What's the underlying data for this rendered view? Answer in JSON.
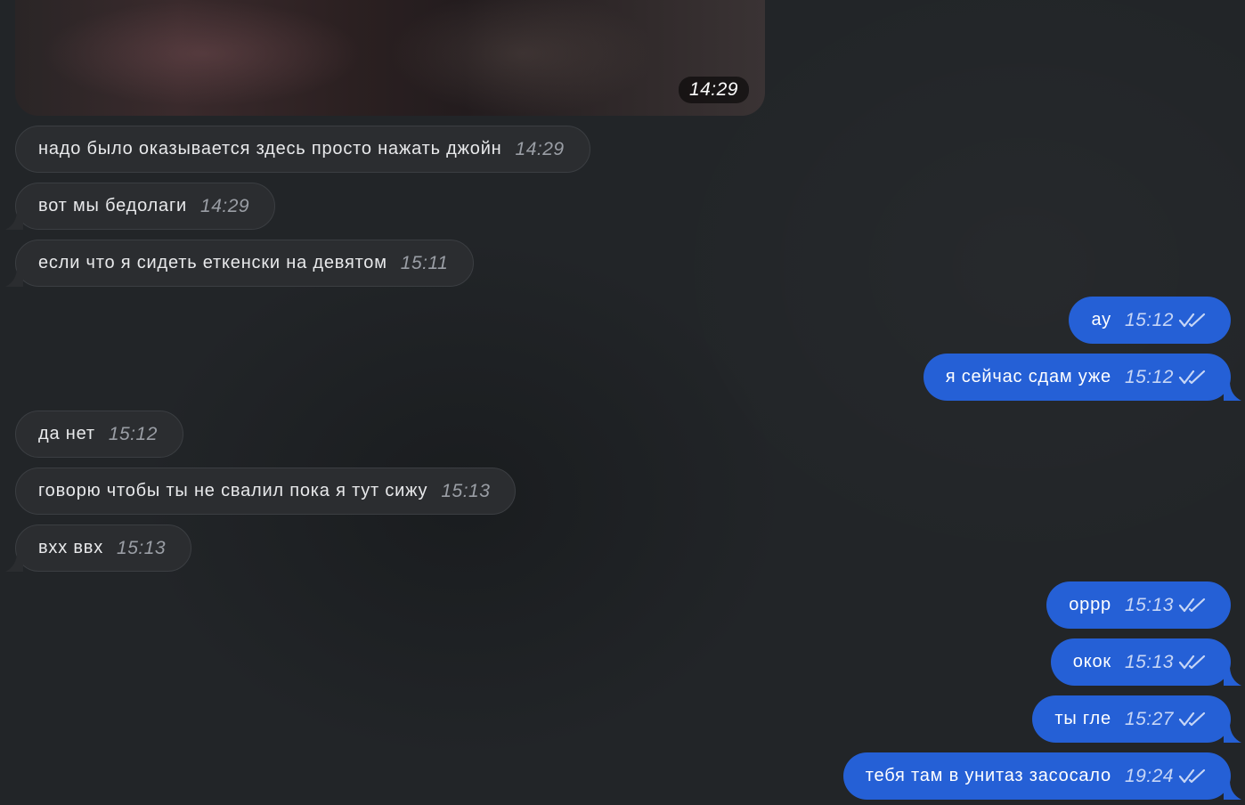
{
  "photo": {
    "time": "14:29"
  },
  "incoming": [
    {
      "text": "надо было оказывается здесь просто нажать джойн",
      "time": "14:29"
    },
    {
      "text": "вот мы бедолаги",
      "time": "14:29"
    },
    {
      "text": "если что я сидеть еткенски на девятом",
      "time": "15:11"
    },
    {
      "text": "да нет",
      "time": "15:12"
    },
    {
      "text": "говорю чтобы ты не свалил пока я тут сижу",
      "time": "15:13"
    },
    {
      "text": "вхх ввх",
      "time": "15:13"
    }
  ],
  "outgoing": [
    {
      "text": "ау",
      "time": "15:12"
    },
    {
      "text": "я сейчас сдам уже",
      "time": "15:12"
    },
    {
      "text": "оррр",
      "time": "15:13"
    },
    {
      "text": "окок",
      "time": "15:13"
    },
    {
      "text": "ты гле",
      "time": "15:27"
    },
    {
      "text": "тебя там в унитаз засосало",
      "time": "19:24"
    }
  ],
  "colors": {
    "background": "#222528",
    "incoming_bubble": "#2b2d30",
    "outgoing_bubble": "#2560d6",
    "outgoing_time": "#c7d6f6",
    "incoming_time": "#9a9ea5"
  },
  "icons": {
    "read_status": "double-check-icon",
    "bubble_tail": "bubble-tail-icon"
  }
}
